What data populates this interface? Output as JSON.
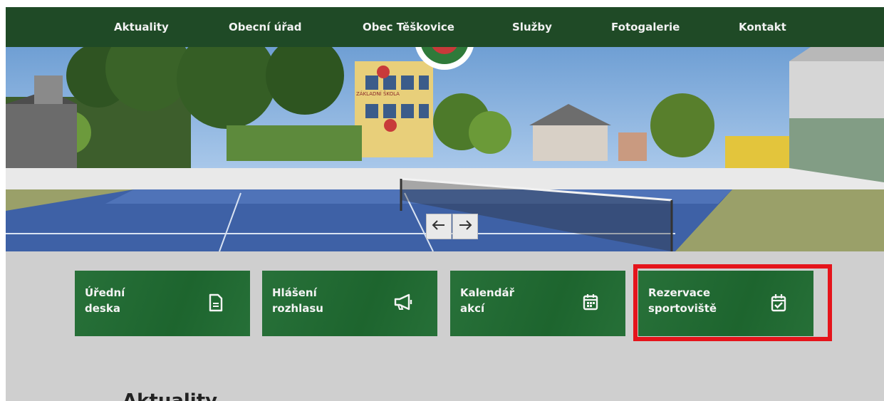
{
  "nav": {
    "items": [
      {
        "label": "Aktuality"
      },
      {
        "label": "Obecní úřad"
      },
      {
        "label": "Obec Těškovice"
      },
      {
        "label": "Služby"
      },
      {
        "label": "Fotogalerie"
      },
      {
        "label": "Kontakt"
      }
    ]
  },
  "hero": {
    "school_sign": "ZÁKLADNÍ ŠKOLA",
    "prev_icon": "arrow-left-icon",
    "next_icon": "arrow-right-icon"
  },
  "tiles": [
    {
      "label": "Úřední\ndeska",
      "icon": "document-icon"
    },
    {
      "label": "Hlášení\nrozhlasu",
      "icon": "megaphone-icon"
    },
    {
      "label": "Kalendář\nakcí",
      "icon": "calendar-icon"
    },
    {
      "label": "Rezervace\nsportoviště",
      "icon": "calendar-check-icon"
    }
  ],
  "section": {
    "title": "Aktuality"
  },
  "colors": {
    "nav_bg": "#1f4a26",
    "tile_bg": "#1f6b31",
    "page_bg": "#cfcfcf",
    "highlight": "#e5141b"
  }
}
